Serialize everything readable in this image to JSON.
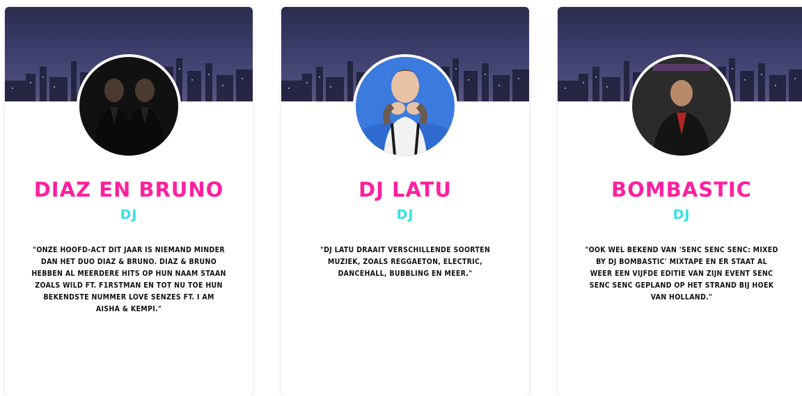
{
  "performers": [
    {
      "name": "Diaz en Bruno",
      "role": "DJ",
      "avatar_icon": "performer-photo-duo",
      "quote": "\"Onze hoofd-act dit jaar is niemand minder dan het duo Diaz & Bruno. Diaz & Bruno hebben al meerdere hits op hun naam staan zoals Wild ft. F1rstman en tot nu toe hun bekendste nummer Love Senzes ft. I am Aisha & Kempi.\""
    },
    {
      "name": "DJ Latu",
      "role": "DJ",
      "avatar_icon": "performer-photo-latu",
      "quote": "\"DJ Latu draait verschillende soorten muziek, zoals reggaeton, electric, dancehall, bubbling en meer.\""
    },
    {
      "name": "Bombastic",
      "role": "DJ",
      "avatar_icon": "performer-photo-bombastic",
      "quote": "\"Ook wel bekend van 'Senc Senc Senc: Mixed by DJ Bombastic' mixtape en er staat al weer een vijfde editie van zijn event Senc Senc Senc gepland op het strand bij Hoek van Holland.\""
    }
  ],
  "colors": {
    "name": "#ff1f9e",
    "role": "#37e2e0",
    "quote": "#111111",
    "banner": "#3a3b68"
  }
}
